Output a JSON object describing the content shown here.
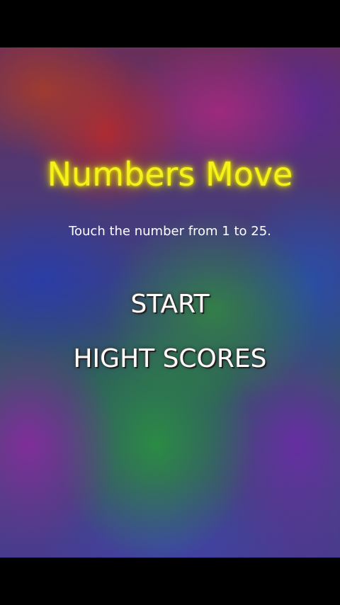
{
  "game": {
    "title": "Numbers Move",
    "subtitle": "Touch the number from 1 to 25.",
    "menu": {
      "start_label": "START",
      "high_scores_label": "HIGHT SCORES"
    },
    "colors": {
      "title": "#f4f21a",
      "menu_text": "#ffffff",
      "letterbox": "#000000"
    }
  }
}
